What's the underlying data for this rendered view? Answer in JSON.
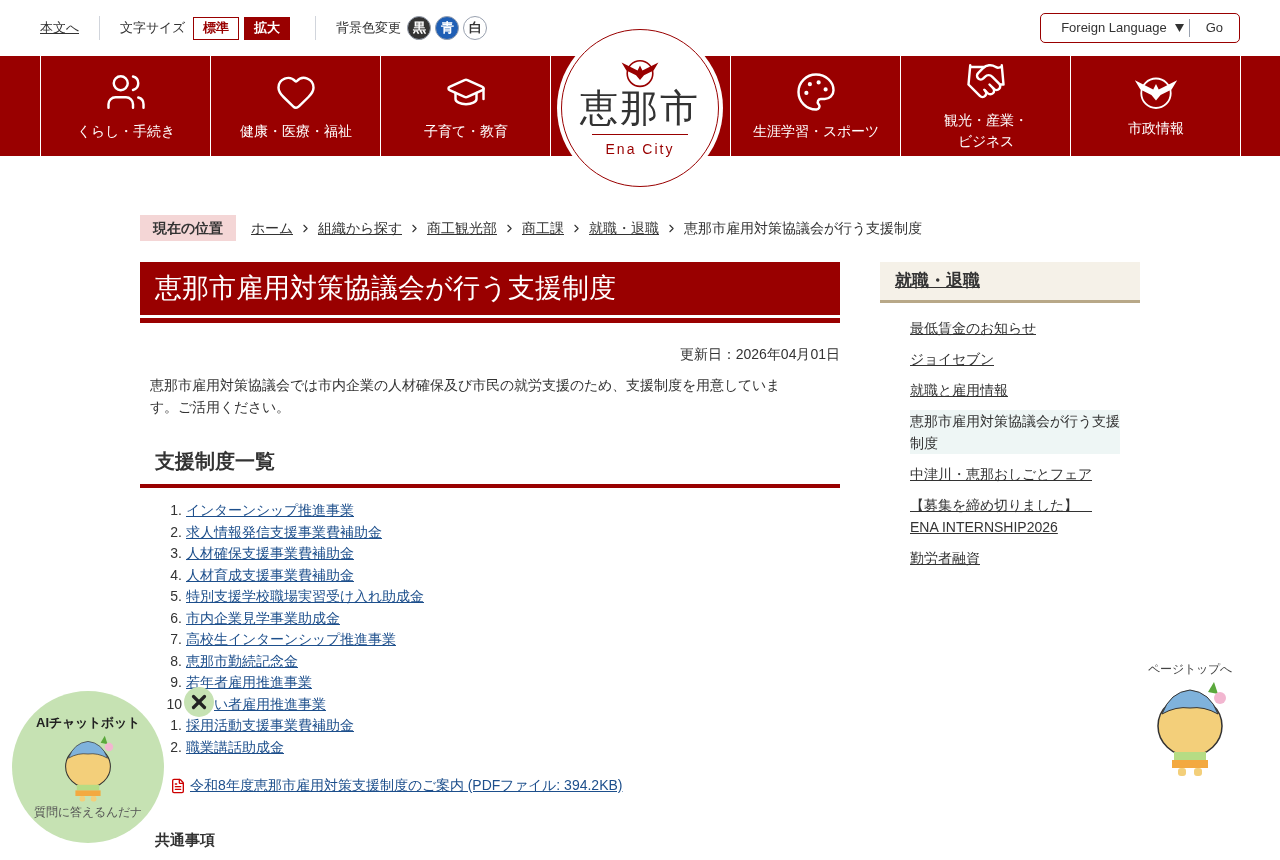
{
  "header": {
    "skip_link": "本文へ",
    "font_size": {
      "label": "文字サイズ",
      "options": [
        {
          "label": "標準",
          "selected": false
        },
        {
          "label": "拡大",
          "selected": true
        }
      ]
    },
    "background_color": {
      "label": "背景色変更",
      "options": [
        {
          "label": "黒",
          "color": "#333333"
        },
        {
          "label": "青",
          "color": "#1f5fb5"
        },
        {
          "label": "白",
          "color": "#ffffff"
        }
      ]
    },
    "language": {
      "value": "Foreign Language",
      "button": "Go"
    }
  },
  "nav": {
    "items": [
      {
        "label": "くらし・手続き",
        "kind": "people"
      },
      {
        "label": "健康・医療・福祉",
        "kind": "heart"
      },
      {
        "label": "子育て・教育",
        "kind": "cap"
      },
      {
        "label": "生涯学習・スポーツ",
        "kind": "palette"
      },
      {
        "label": "観光・産業・ビジネス",
        "kind": "handshake"
      },
      {
        "label": "市政情報",
        "kind": "emblem"
      }
    ]
  },
  "logo": {
    "name": "恵那市",
    "subtitle": "Ena City"
  },
  "breadcrumb": {
    "label": "現在の位置",
    "links": [
      "ホーム",
      "組織から探す",
      "商工観光部",
      "商工課",
      "就職・退職"
    ],
    "current": "恵那市雇用対策協議会が行う支援制度"
  },
  "page": {
    "title": "恵那市雇用対策協議会が行う支援制度",
    "updated": "更新日：2026年04月01日",
    "intro": "恵那市雇用対策協議会では市内企業の人材確保及び市民の就労支援のため、支援制度を用意しています。ご活用ください。",
    "section_heading": "支援制度一覧",
    "items": [
      {
        "number": "1.",
        "label": "インターンシップ推進事業",
        "covered": false
      },
      {
        "number": "2.",
        "label": "求人情報発信支援事業費補助金 ",
        "covered": false
      },
      {
        "number": "3.",
        "label": "人材確保支援事業費補助金",
        "covered": false
      },
      {
        "number": "4.",
        "label": "人材育成支援事業費補助金",
        "covered": false
      },
      {
        "number": "5.",
        "label": "特別支援学校職場実習受け入れ助成金",
        "covered": false
      },
      {
        "number": "6.",
        "label": "市内企業見学事業助成金",
        "covered": false
      },
      {
        "number": "7.",
        "label": "高校生インターンシップ推進事業",
        "covered": false
      },
      {
        "number": "8.",
        "label": "恵那市勤続記念金",
        "covered": false
      },
      {
        "number": "9.",
        "label": "若年者雇用推進事業",
        "covered": false
      },
      {
        "number": "10",
        "label": "い者雇用推進事業",
        "covered": true
      },
      {
        "number": "1.",
        "label": "採用活動支援事業費補助金",
        "covered": false
      },
      {
        "number": "2.",
        "label": "職業講話助成金",
        "covered": false
      }
    ],
    "attachment": "令和8年度恵那市雇用対策支援制度のご案内 (PDFファイル: 394.2KB)",
    "subheading": "共通事項"
  },
  "sidebar": {
    "heading": "就職・退職",
    "items": [
      {
        "label": "最低賃金のお知らせ",
        "selected": false
      },
      {
        "label": "ジョイセブン",
        "selected": false
      },
      {
        "label": "就職と雇用情報",
        "selected": false
      },
      {
        "label": "恵那市雇用対策協議会が行う支援制度",
        "selected": true
      },
      {
        "label": "中津川・恵那おしごとフェア",
        "selected": false
      },
      {
        "label": "【募集を締め切りました】　ENA INTERNSHIP2026",
        "selected": false
      },
      {
        "label": "勤労者融資",
        "selected": false
      }
    ]
  },
  "chatbot": {
    "title": "AIチャットボット",
    "caption": "質問に答えるんだナ"
  },
  "page_top": {
    "label": "ページトップへ"
  }
}
